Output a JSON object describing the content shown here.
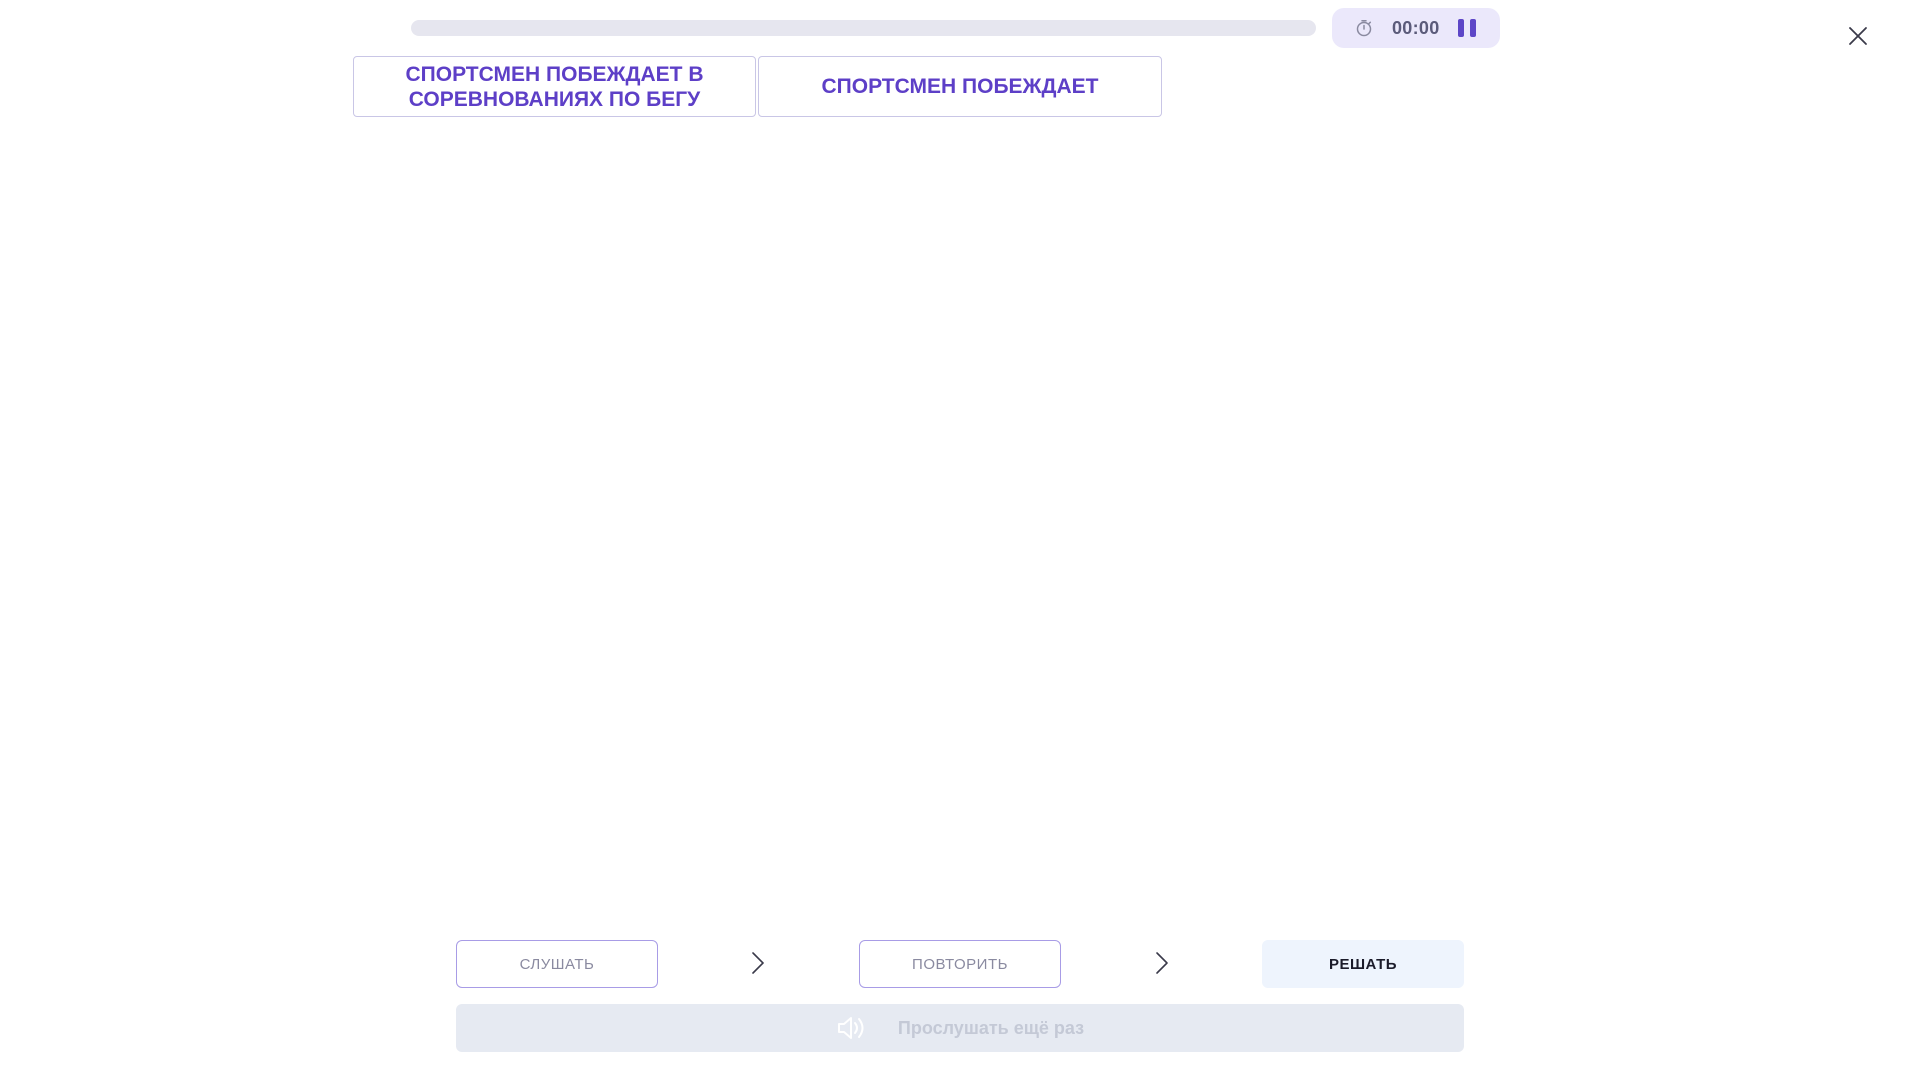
{
  "progress": {
    "fraction": 0
  },
  "timer": {
    "time": "00:00"
  },
  "cards": [
    {
      "text": "СПОРТСМЕН ПОБЕЖДАЕТ В СОРЕВНОВАНИЯХ ПО БЕГУ"
    },
    {
      "text": "СПОРТСМЕН ПОБЕЖДАЕТ"
    }
  ],
  "steps": {
    "listen": "СЛУШАТЬ",
    "repeat": "ПОВТОРИТЬ",
    "solve": "РЕШАТЬ"
  },
  "listen_again": {
    "label": "Прослушать ещё раз"
  },
  "colors": {
    "accent": "#5d46c7",
    "card_text": "#5d3fc7",
    "timer_bg": "#ebe8fb",
    "solve_bg": "#eef4fd",
    "listen_again_bg": "#e6eaf2"
  }
}
